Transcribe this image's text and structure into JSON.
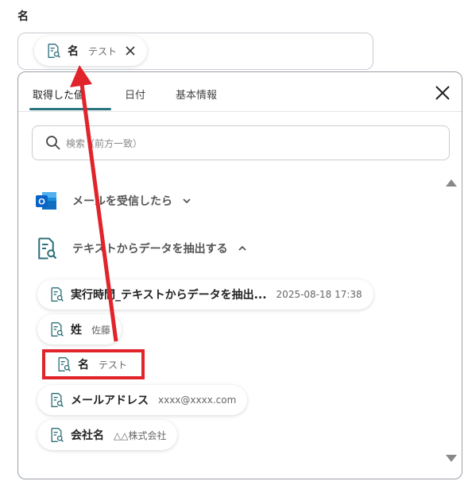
{
  "field": {
    "label": "名",
    "selected_chip": {
      "name": "名",
      "value": "テスト"
    }
  },
  "panel": {
    "tabs": [
      {
        "label": "取得した値",
        "active": true
      },
      {
        "label": "日付",
        "active": false
      },
      {
        "label": "基本情報",
        "active": false
      }
    ],
    "search_placeholder": "検索（前方一致）",
    "sections": [
      {
        "title": "メールを受信したら",
        "expanded": false,
        "icon": "outlook-icon"
      },
      {
        "title": "テキストからデータを抽出する",
        "expanded": true,
        "icon": "document-search-icon"
      }
    ],
    "items": [
      {
        "name": "実行時間_テキストからデータを抽出...",
        "value": "2025-08-18 17:38"
      },
      {
        "name": "姓",
        "value": "佐藤"
      },
      {
        "name": "名",
        "value": "テスト"
      },
      {
        "name": "メールアドレス",
        "value": "xxxx@xxxx.com"
      },
      {
        "name": "会社名",
        "value": "△△株式会社"
      }
    ]
  },
  "colors": {
    "accent_tab": "#27737e",
    "annotation_red": "#e0242a",
    "outlook_blue": "#0a64c8"
  }
}
